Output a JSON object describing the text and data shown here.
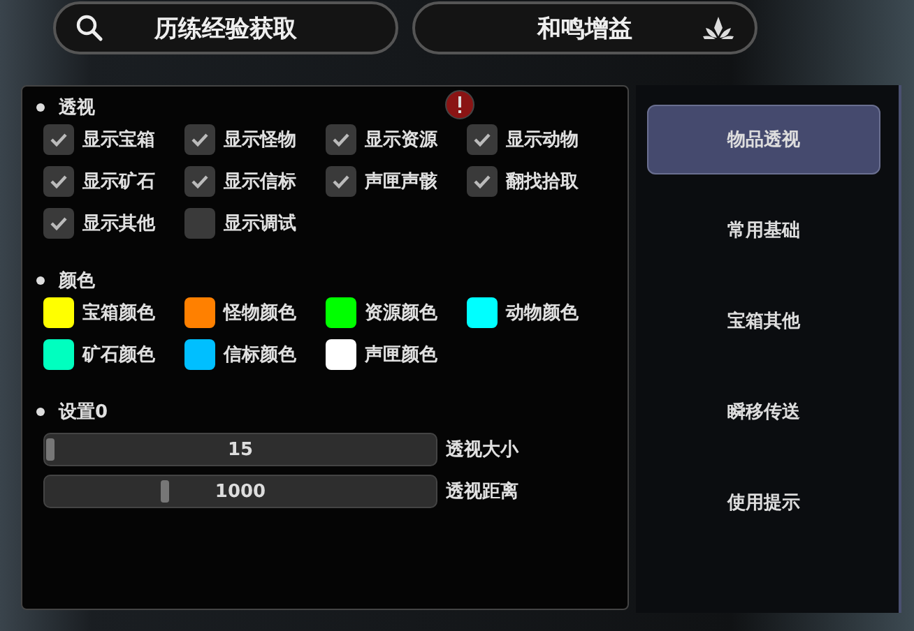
{
  "top_buttons": [
    {
      "label": "历练经验获取"
    },
    {
      "label": "和鸣增益"
    }
  ],
  "sections": [
    {
      "title": "透视",
      "kind": "checks",
      "items": [
        {
          "label": "显示宝箱",
          "checked": true
        },
        {
          "label": "显示怪物",
          "checked": true
        },
        {
          "label": "显示资源",
          "checked": true
        },
        {
          "label": "显示动物",
          "checked": true
        },
        {
          "label": "显示矿石",
          "checked": true
        },
        {
          "label": "显示信标",
          "checked": true
        },
        {
          "label": "声匣声骸",
          "checked": true
        },
        {
          "label": "翻找拾取",
          "checked": true
        },
        {
          "label": "显示其他",
          "checked": true
        },
        {
          "label": "显示调试",
          "checked": false
        }
      ]
    },
    {
      "title": "颜色",
      "kind": "colors",
      "items": [
        {
          "label": "宝箱颜色",
          "color": "#ffff00"
        },
        {
          "label": "怪物颜色",
          "color": "#ff8000"
        },
        {
          "label": "资源颜色",
          "color": "#00ff00"
        },
        {
          "label": "动物颜色",
          "color": "#00ffff"
        },
        {
          "label": "矿石颜色",
          "color": "#00ffbf"
        },
        {
          "label": "信标颜色",
          "color": "#00bfff"
        },
        {
          "label": "声匣颜色",
          "color": "#ffffff"
        }
      ]
    },
    {
      "title": "设置0",
      "kind": "sliders",
      "items": [
        {
          "label": "透视大小",
          "value": "15",
          "level": 0.0
        },
        {
          "label": "透视距离",
          "value": "1000",
          "level": 0.3
        }
      ]
    }
  ],
  "sidebar": {
    "items": [
      {
        "label": "物品透视",
        "selected": true
      },
      {
        "label": "常用基础",
        "selected": false
      },
      {
        "label": "宝箱其他",
        "selected": false
      },
      {
        "label": "瞬移传送",
        "selected": false
      },
      {
        "label": "使用提示",
        "selected": false
      }
    ]
  }
}
